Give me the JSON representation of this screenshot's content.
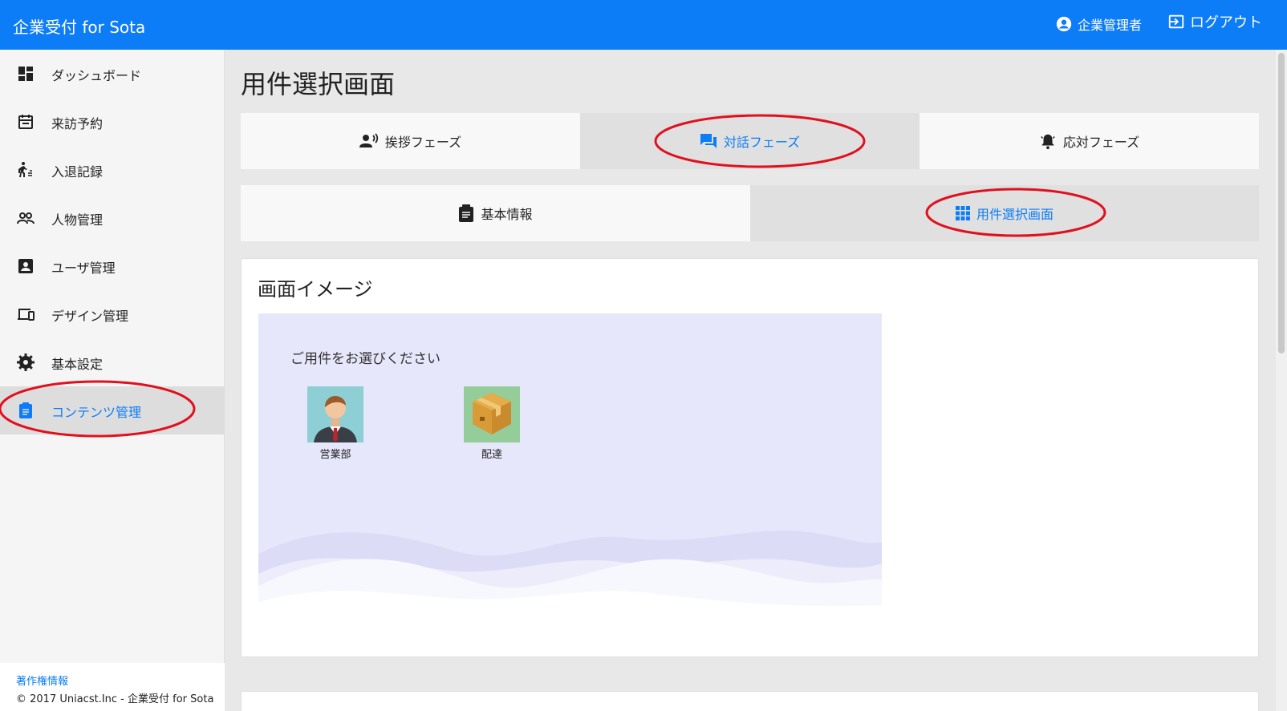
{
  "header": {
    "brand": "企業受付 for Sota",
    "user": "企業管理者",
    "logout": "ログアウト"
  },
  "sidebar": {
    "items": [
      {
        "label": "ダッシュボード",
        "icon": "dashboard-icon"
      },
      {
        "label": "来訪予約",
        "icon": "calendar-icon"
      },
      {
        "label": "入退記録",
        "icon": "walking-icon"
      },
      {
        "label": "人物管理",
        "icon": "people-icon"
      },
      {
        "label": "ユーザ管理",
        "icon": "account-box-icon"
      },
      {
        "label": "デザイン管理",
        "icon": "devices-icon"
      },
      {
        "label": "基本設定",
        "icon": "gear-icon"
      },
      {
        "label": "コンテンツ管理",
        "icon": "clipboard-icon"
      }
    ],
    "active_index": 7,
    "footer_link": "著作権情報",
    "footer_copy": "© 2017 Uniacst.Inc - 企業受付 for Sota"
  },
  "main": {
    "title": "用件選択画面",
    "phase_tabs": [
      {
        "label": "挨拶フェーズ",
        "icon": "speaking-person-icon"
      },
      {
        "label": "対話フェーズ",
        "icon": "chat-icon"
      },
      {
        "label": "応対フェーズ",
        "icon": "bell-icon"
      }
    ],
    "phase_selected": 1,
    "sub_tabs": [
      {
        "label": "基本情報",
        "icon": "clipboard-icon"
      },
      {
        "label": "用件選択画面",
        "icon": "grid-icon"
      }
    ],
    "sub_selected": 1,
    "card_title": "画面イメージ",
    "preview": {
      "question": "ご用件をお選びください",
      "options": [
        {
          "label": "営業部",
          "icon": "businessman-icon"
        },
        {
          "label": "配達",
          "icon": "package-icon"
        }
      ]
    }
  },
  "colors": {
    "accent": "#0d7cf7",
    "annotation": "#e0101e",
    "preview_bg": "#e6e7fb"
  }
}
